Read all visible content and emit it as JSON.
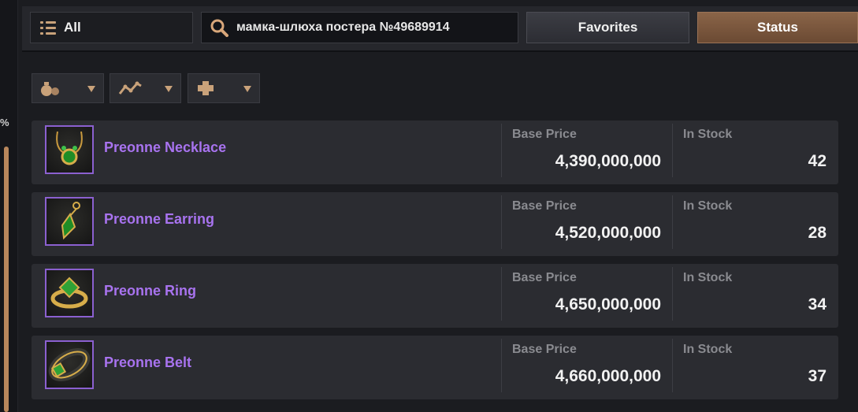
{
  "left_panel": {
    "percent_symbol": "%"
  },
  "toolbar": {
    "category_label": "All",
    "search_value": "мамка-шлюха постера №49689914",
    "favorites_label": "Favorites",
    "status_label": "Status"
  },
  "filters": [
    {
      "icon": "pouch-icon"
    },
    {
      "icon": "trend-line-icon"
    },
    {
      "icon": "plus-icon"
    }
  ],
  "items": [
    {
      "name": "Preonne Necklace",
      "price_label": "Base Price",
      "price": "4,390,000,000",
      "stock_label": "In Stock",
      "stock": "42"
    },
    {
      "name": "Preonne Earring",
      "price_label": "Base Price",
      "price": "4,520,000,000",
      "stock_label": "In Stock",
      "stock": "28"
    },
    {
      "name": "Preonne Ring",
      "price_label": "Base Price",
      "price": "4,650,000,000",
      "stock_label": "In Stock",
      "stock": "34"
    },
    {
      "name": "Preonne Belt",
      "price_label": "Base Price",
      "price": "4,660,000,000",
      "stock_label": "In Stock",
      "stock": "37"
    }
  ],
  "colors": {
    "accent": "#a873ef",
    "status_button": "#7a5640",
    "filter_icon": "#c9a27a"
  }
}
